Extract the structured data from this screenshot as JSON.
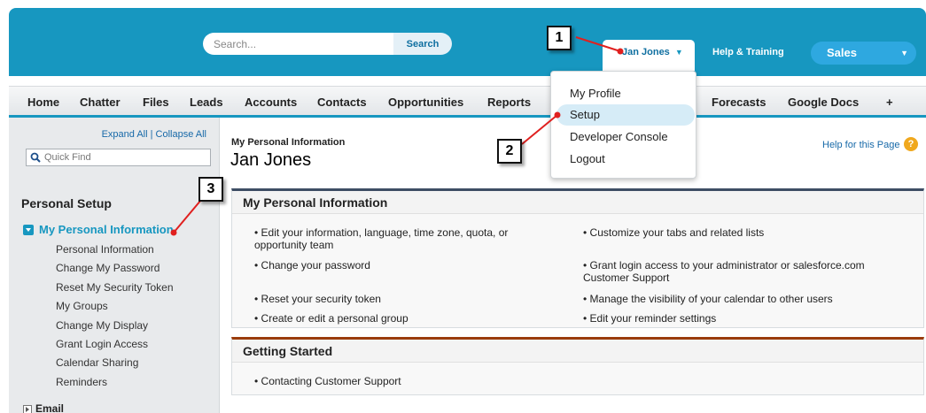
{
  "header": {
    "search_placeholder": "Search...",
    "search_button": "Search",
    "user_name": "Jan Jones",
    "help_training": "Help & Training",
    "app_name": "Sales"
  },
  "user_menu": {
    "items": [
      "My Profile",
      "Setup",
      "Developer Console",
      "Logout"
    ]
  },
  "tabs": [
    "Home",
    "Chatter",
    "Files",
    "Leads",
    "Accounts",
    "Contacts",
    "Opportunities",
    "Reports",
    "Forecasts",
    "Google Docs",
    "+"
  ],
  "sidebar": {
    "expand_collapse": "Expand All | Collapse All",
    "quick_find_placeholder": "Quick Find",
    "section_heading": "Personal Setup",
    "expanded_item": "My Personal Information",
    "sub_items": [
      "Personal Information",
      "Change My Password",
      "Reset My Security Token",
      "My Groups",
      "Change My Display",
      "Grant Login Access",
      "Calendar Sharing",
      "Reminders"
    ],
    "collapsed_item": "Email"
  },
  "main": {
    "breadcrumb": "My Personal Information",
    "title": "Jan Jones",
    "help_link": "Help for this Page",
    "help_icon": "?",
    "panel_mpi": {
      "title": "My Personal Information",
      "left_links": [
        "• Edit your information, language, time zone, quota, or opportunity team",
        "• Change your password",
        "• Reset your security token",
        "• Create or edit a personal group"
      ],
      "right_links": [
        "• Customize your tabs and related lists",
        "• Grant login access to your administrator or salesforce.com Customer Support",
        "• Manage the visibility of your calendar to other users",
        "• Edit your reminder settings"
      ]
    },
    "panel_gs": {
      "title": "Getting Started",
      "links": [
        "• Contacting Customer Support"
      ]
    }
  },
  "callouts": [
    "1",
    "2",
    "3"
  ],
  "colors": {
    "header_bg": "#1797c0",
    "tab_accent": "#1797c0",
    "link": "#1769a8",
    "annotation_arrow": "#e0201f",
    "panel_mpi_border": "#3d4d64",
    "panel_gs_border": "#9a3c0c"
  }
}
